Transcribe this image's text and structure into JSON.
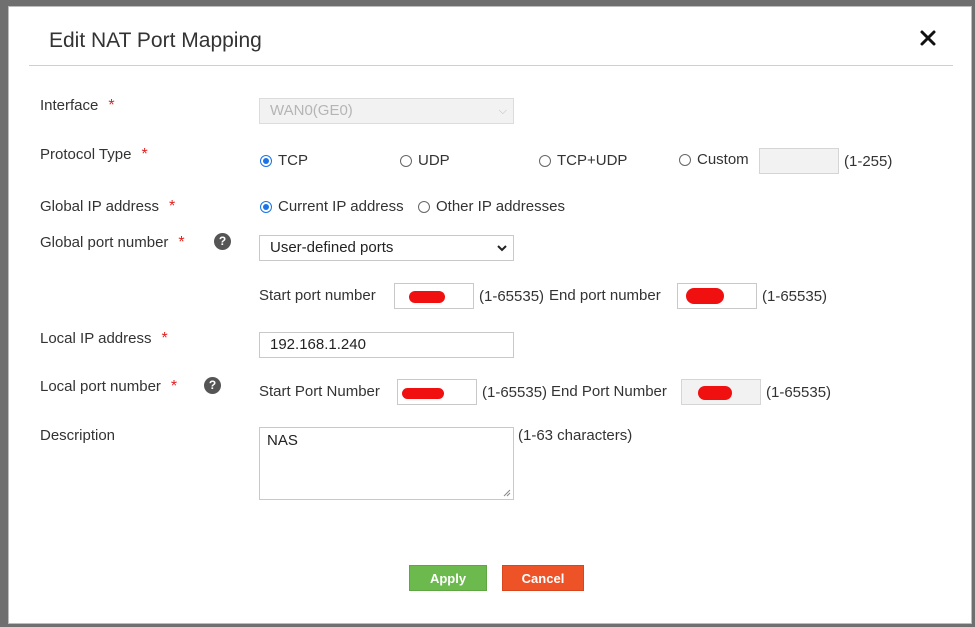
{
  "dialog": {
    "title": "Edit NAT Port Mapping"
  },
  "form": {
    "required_mark": "*",
    "interface": {
      "label": "Interface",
      "value": "WAN0(GE0)"
    },
    "protocol": {
      "label": "Protocol Type",
      "options": [
        "TCP",
        "UDP",
        "TCP+UDP",
        "Custom"
      ],
      "selected": "TCP",
      "custom_range": "(1-255)"
    },
    "global_ip": {
      "label": "Global IP address",
      "options": [
        "Current IP address",
        "Other IP addresses"
      ],
      "selected": "Current IP address"
    },
    "global_port": {
      "label": "Global port number",
      "help": "?",
      "value": "User-defined ports",
      "start_label": "Start port number",
      "start_range": "(1-65535)",
      "end_label": "End port number",
      "end_range": "(1-65535)"
    },
    "local_ip": {
      "label": "Local IP address",
      "value": "192.168.1.240"
    },
    "local_port": {
      "label": "Local port number",
      "help": "?",
      "start_label": "Start Port Number",
      "start_range": "(1-65535)",
      "end_label": "End Port Number",
      "end_range": "(1-65535)"
    },
    "description": {
      "label": "Description",
      "value": "NAS",
      "hint": "(1-63 characters)"
    }
  },
  "buttons": {
    "apply": "Apply",
    "cancel": "Cancel"
  },
  "colors": {
    "apply": "#6cb94e",
    "cancel": "#ee5328",
    "required": "#e02020",
    "radio_selected": "#1a73e8"
  },
  "icons": {
    "close": "close-icon",
    "help": "help-icon",
    "dropdown": "chevron-down-icon"
  }
}
